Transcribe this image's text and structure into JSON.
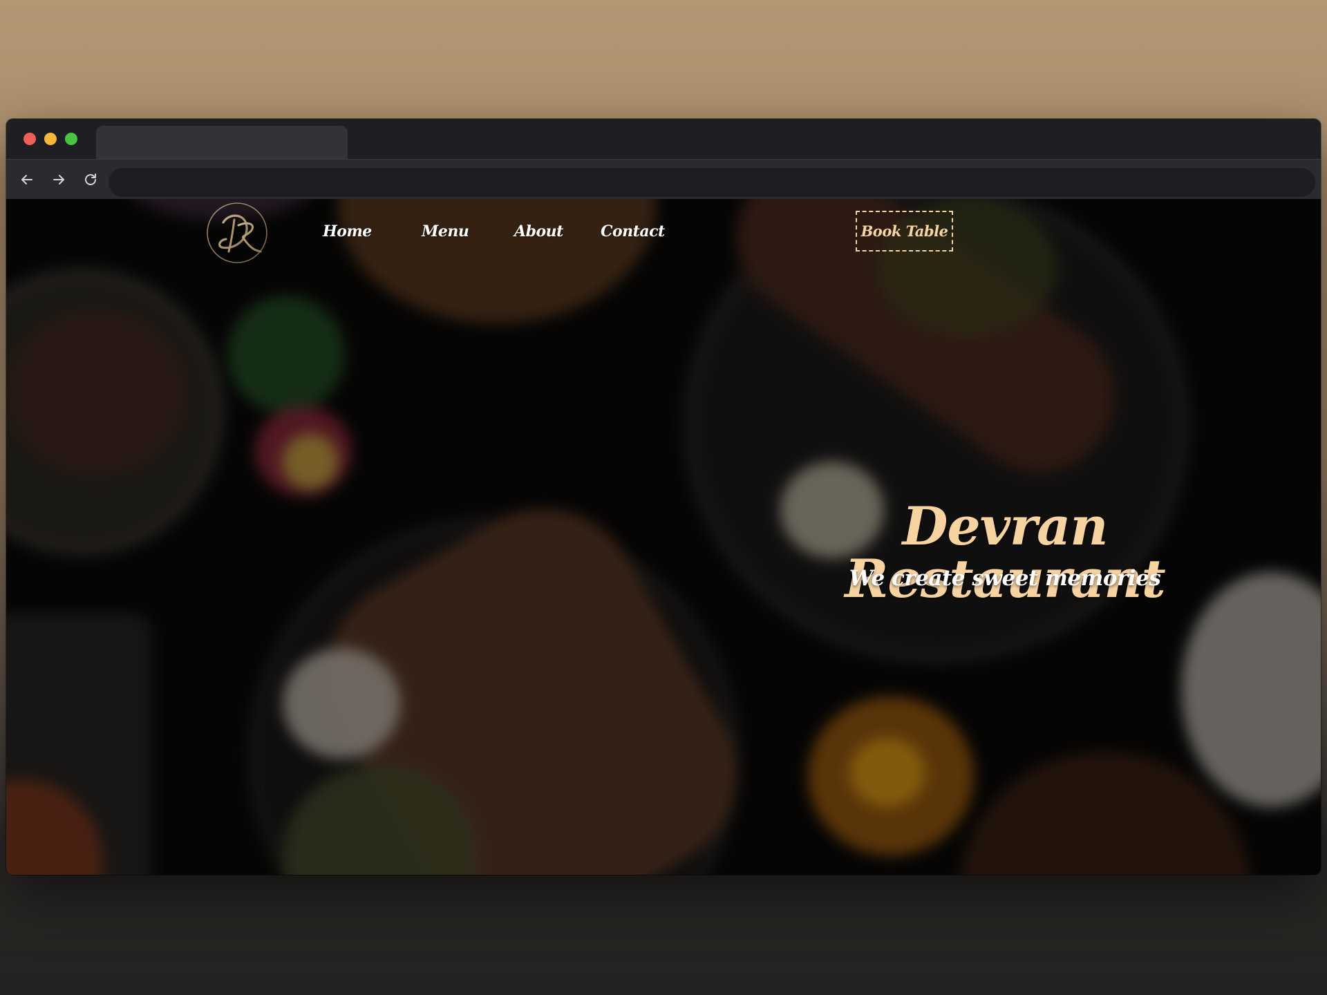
{
  "browser": {
    "tab_title": "",
    "address_value": "",
    "address_placeholder": "",
    "icons": {
      "back": "arrow-left-icon",
      "forward": "arrow-right-icon",
      "reload": "reload-icon"
    }
  },
  "site": {
    "logo_icon": "dr-monogram-logo",
    "nav": {
      "home": "Home",
      "menu": "Menu",
      "about": "About",
      "contact": "Contact"
    },
    "book_button": "Book Table",
    "hero": {
      "title": "Devran Restaurant",
      "tagline": "We create sweet memories"
    }
  },
  "colors": {
    "accent": "#f8d3a2",
    "nav_text": "#ffffff",
    "book_border": "#f5d3a3"
  }
}
